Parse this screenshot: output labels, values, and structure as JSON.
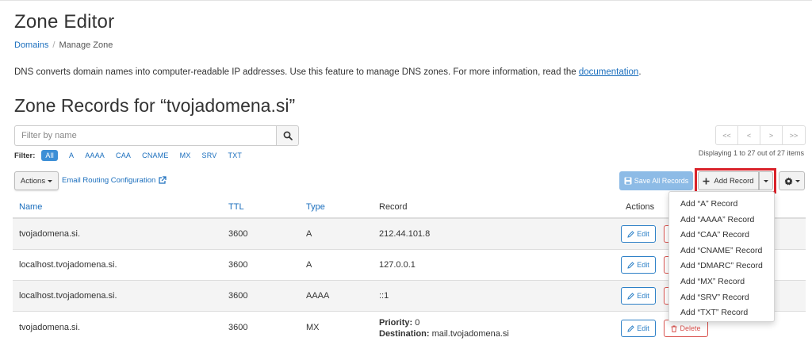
{
  "page": {
    "title": "Zone Editor",
    "breadcrumb": {
      "root": "Domains",
      "current": "Manage Zone"
    },
    "description": "DNS converts domain names into computer-readable IP addresses. Use this feature to manage DNS zones. For more information, read the ",
    "description_link": "documentation",
    "description_end": "."
  },
  "zone": {
    "heading": "Zone Records for “tvojadomena.si”"
  },
  "search": {
    "placeholder": "Filter by name",
    "icon": "search-icon"
  },
  "filter": {
    "label": "Filter:",
    "options": [
      "All",
      "A",
      "AAAA",
      "CAA",
      "CNAME",
      "MX",
      "SRV",
      "TXT"
    ],
    "active": "All"
  },
  "pager": {
    "buttons": [
      "<<",
      "<",
      ">",
      ">>"
    ],
    "info": "Displaying 1 to 27 out of 27 items"
  },
  "toolbar": {
    "actions_label": "Actions",
    "email_routing_label": "Email Routing Configuration",
    "save_all_label": "Save All Records",
    "add_record_label": "Add Record",
    "save_color": "#8dbbe6",
    "highlight_color": "#d9222a"
  },
  "table": {
    "headers": {
      "name": "Name",
      "ttl": "TTL",
      "type": "Type",
      "record": "Record",
      "actions": "Actions"
    },
    "rows": [
      {
        "name": "tvojadomena.si.",
        "ttl": "3600",
        "type": "A",
        "record": "212.44.101.8"
      },
      {
        "name": "localhost.tvojadomena.si.",
        "ttl": "3600",
        "type": "A",
        "record": "127.0.0.1"
      },
      {
        "name": "localhost.tvojadomena.si.",
        "ttl": "3600",
        "type": "AAAA",
        "record": "::1"
      },
      {
        "name": "tvojadomena.si.",
        "ttl": "3600",
        "type": "MX",
        "priority_label": "Priority:",
        "priority": "0",
        "destination_label": "Destination:",
        "destination": "mail.tvojadomena.si"
      }
    ],
    "edit_label": "Edit",
    "delete_label": "Delete"
  },
  "add_menu": {
    "items": [
      "Add “A” Record",
      "Add “AAAA” Record",
      "Add “CAA” Record",
      "Add “CNAME” Record",
      "Add “DMARC” Record",
      "Add “MX” Record",
      "Add “SRV” Record",
      "Add “TXT” Record"
    ]
  }
}
